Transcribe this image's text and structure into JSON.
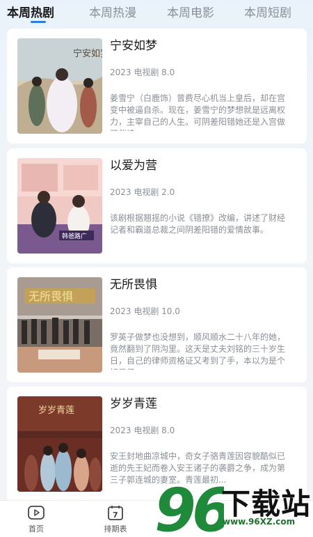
{
  "tabs": [
    {
      "label": "本周热剧",
      "active": true
    },
    {
      "label": "本周热漫",
      "active": false
    },
    {
      "label": "本周电影",
      "active": false
    },
    {
      "label": "本周短剧",
      "active": false
    }
  ],
  "accent_color": "#2a7de1",
  "items": [
    {
      "title": "宁安如梦",
      "meta": "2023 电视剧 8.0",
      "desc": "姜雪宁（白鹿饰）曾费尽心机当上皇后，却在宫变中被逼自杀。现在，姜雪宁的梦想就是远离权力，主宰自己的人生。可阴差阳错她还是入宫做了伴读..."
    },
    {
      "title": "以爱为营",
      "meta": "2023 电视剧 2.0",
      "desc": "该剧根据翘摇的小说《错撩》改编，讲述了财经记者和霸道总裁之间阴差阳错的爱情故事。"
    },
    {
      "title": "无所畏惧",
      "meta": "2023 电视剧 10.0",
      "desc": "罗英子做梦也没想到，顺风顺水二十八年的她，竟然翻到了阴沟里。这天是丈夫刘铭的三十岁生日，自己的律师资格证又考到了手，本以为是个好日子，..."
    },
    {
      "title": "岁岁青莲",
      "meta": "2023 电视剧 8.0",
      "desc": "安王封地曲凉城中，奇女子骆青莲因容貌酷似已逝的先王妃而卷入安王诸子的袭爵之争，成为第三子郭连城的妻室。青莲最初..."
    }
  ],
  "posters": [
    {
      "text": "宁安如梦",
      "icon": "poster-image"
    },
    {
      "text": "韩爸路广",
      "icon": "poster-image"
    },
    {
      "text": "无所畏惧",
      "icon": "poster-image"
    },
    {
      "text": "岁岁青莲",
      "icon": "poster-image"
    }
  ],
  "nav": [
    {
      "label": "首页",
      "icon": "play-icon"
    },
    {
      "label": "排期表",
      "icon": "calendar-icon",
      "day": "7"
    }
  ],
  "watermark": {
    "digits": "96",
    "brand": "下载站",
    "url": "www.96XZ.com"
  }
}
